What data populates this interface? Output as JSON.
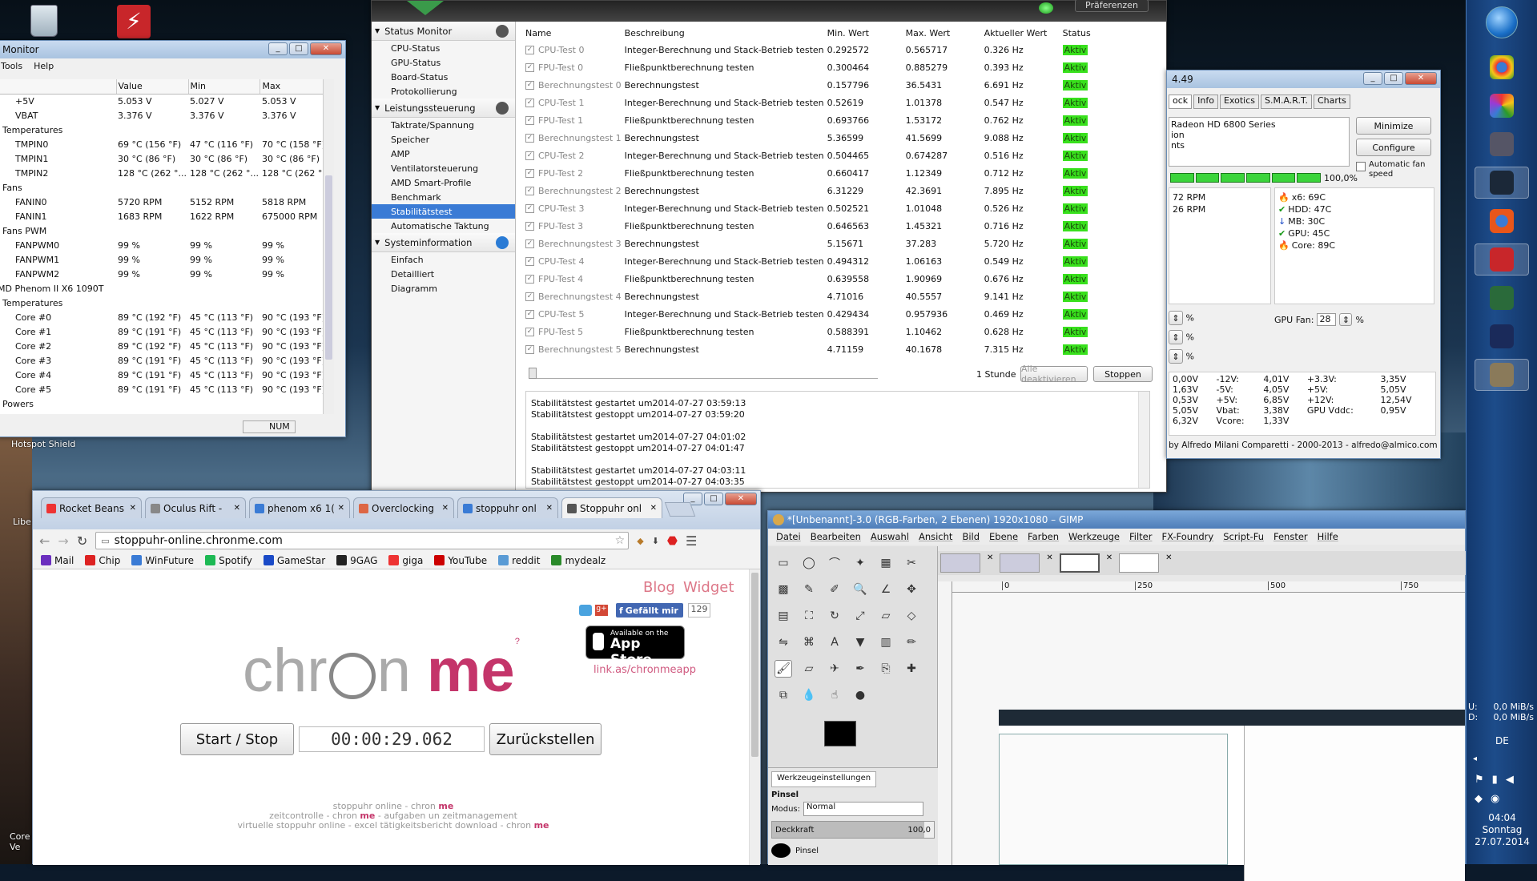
{
  "desktop": {
    "game_caption": "Hotspot Shield",
    "cut_label_1": "Libe",
    "cut_label_2": "Core\nVe"
  },
  "hwmonitor": {
    "title": "Monitor",
    "menu": [
      "Tools",
      "Help"
    ],
    "columns": [
      "",
      "Value",
      "Min",
      "Max"
    ],
    "rows": [
      {
        "indent": 2,
        "name": "+5V",
        "value": "5.053 V",
        "min": "5.027 V",
        "max": "5.053 V"
      },
      {
        "indent": 2,
        "name": "VBAT",
        "value": "3.376 V",
        "min": "3.376 V",
        "max": "3.376 V"
      },
      {
        "indent": 1,
        "name": "Temperatures",
        "value": "",
        "min": "",
        "max": ""
      },
      {
        "indent": 2,
        "name": "TMPIN0",
        "value": "69 °C  (156 °F)",
        "min": "47 °C  (116 °F)",
        "max": "70 °C  (158 °F)"
      },
      {
        "indent": 2,
        "name": "TMPIN1",
        "value": "30 °C  (86 °F)",
        "min": "30 °C  (86 °F)",
        "max": "30 °C  (86 °F)"
      },
      {
        "indent": 2,
        "name": "TMPIN2",
        "value": "128 °C  (262 °...",
        "min": "128 °C  (262 °...",
        "max": "128 °C  (262 °..."
      },
      {
        "indent": 1,
        "name": "Fans",
        "value": "",
        "min": "",
        "max": ""
      },
      {
        "indent": 2,
        "name": "FANIN0",
        "value": "5720 RPM",
        "min": "5152 RPM",
        "max": "5818 RPM"
      },
      {
        "indent": 2,
        "name": "FANIN1",
        "value": "1683 RPM",
        "min": "1622 RPM",
        "max": "675000 RPM"
      },
      {
        "indent": 1,
        "name": "Fans PWM",
        "value": "",
        "min": "",
        "max": ""
      },
      {
        "indent": 2,
        "name": "FANPWM0",
        "value": "99 %",
        "min": "99 %",
        "max": "99 %"
      },
      {
        "indent": 2,
        "name": "FANPWM1",
        "value": "99 %",
        "min": "99 %",
        "max": "99 %"
      },
      {
        "indent": 2,
        "name": "FANPWM2",
        "value": "99 %",
        "min": "99 %",
        "max": "99 %"
      },
      {
        "indent": 0,
        "name": "MD Phenom II X6 1090T",
        "value": "",
        "min": "",
        "max": ""
      },
      {
        "indent": 1,
        "name": "Temperatures",
        "value": "",
        "min": "",
        "max": ""
      },
      {
        "indent": 2,
        "name": "Core #0",
        "value": "89 °C  (192 °F)",
        "min": "45 °C  (113 °F)",
        "max": "90 °C  (193 °F)"
      },
      {
        "indent": 2,
        "name": "Core #1",
        "value": "89 °C  (191 °F)",
        "min": "45 °C  (113 °F)",
        "max": "90 °C  (193 °F)"
      },
      {
        "indent": 2,
        "name": "Core #2",
        "value": "89 °C  (192 °F)",
        "min": "45 °C  (113 °F)",
        "max": "90 °C  (193 °F)"
      },
      {
        "indent": 2,
        "name": "Core #3",
        "value": "89 °C  (191 °F)",
        "min": "45 °C  (113 °F)",
        "max": "90 °C  (193 °F)"
      },
      {
        "indent": 2,
        "name": "Core #4",
        "value": "89 °C  (191 °F)",
        "min": "45 °C  (113 °F)",
        "max": "90 °C  (193 °F)"
      },
      {
        "indent": 2,
        "name": "Core #5",
        "value": "89 °C  (191 °F)",
        "min": "45 °C  (113 °F)",
        "max": "90 °C  (193 °F)"
      },
      {
        "indent": 1,
        "name": "Powers",
        "value": "",
        "min": "",
        "max": ""
      }
    ],
    "status": "NUM"
  },
  "statusmon": {
    "top_button": "Präferenzen",
    "sections": [
      {
        "title": "Status Monitor",
        "items": [
          "CPU-Status",
          "GPU-Status",
          "Board-Status",
          "Protokollierung"
        ]
      },
      {
        "title": "Leistungssteuerung",
        "items": [
          "Taktrate/Spannung",
          "Speicher",
          "AMP",
          "Ventilatorsteuerung",
          "AMD Smart-Profile",
          "Benchmark",
          "Stabilitätstest",
          "Automatische Taktung"
        ]
      },
      {
        "title": "Systeminformation",
        "items": [
          "Einfach",
          "Detailliert",
          "Diagramm"
        ]
      }
    ],
    "selected_item": "Stabilitätstest",
    "columns": [
      "Name",
      "Beschreibung",
      "Min. Wert",
      "Max. Wert",
      "Aktueller Wert",
      "Status"
    ],
    "rows": [
      [
        "CPU-Test 0",
        "Integer-Berechnung und Stack-Betrieb testen",
        "0.292572",
        "0.565717",
        "0.326 Hz",
        "Aktiv"
      ],
      [
        "FPU-Test 0",
        "Fließpunktberechnung testen",
        "0.300464",
        "0.885279",
        "0.393 Hz",
        "Aktiv"
      ],
      [
        "Berechnungstest 0",
        "Berechnungstest",
        "0.157796",
        "36.5431",
        "6.691 Hz",
        "Aktiv"
      ],
      [
        "CPU-Test 1",
        "Integer-Berechnung und Stack-Betrieb testen",
        "0.52619",
        "1.01378",
        "0.547 Hz",
        "Aktiv"
      ],
      [
        "FPU-Test 1",
        "Fließpunktberechnung testen",
        "0.693766",
        "1.53172",
        "0.762 Hz",
        "Aktiv"
      ],
      [
        "Berechnungstest 1",
        "Berechnungstest",
        "5.36599",
        "41.5699",
        "9.088 Hz",
        "Aktiv"
      ],
      [
        "CPU-Test 2",
        "Integer-Berechnung und Stack-Betrieb testen",
        "0.504465",
        "0.674287",
        "0.516 Hz",
        "Aktiv"
      ],
      [
        "FPU-Test 2",
        "Fließpunktberechnung testen",
        "0.660417",
        "1.12349",
        "0.712 Hz",
        "Aktiv"
      ],
      [
        "Berechnungstest 2",
        "Berechnungstest",
        "6.31229",
        "42.3691",
        "7.895 Hz",
        "Aktiv"
      ],
      [
        "CPU-Test 3",
        "Integer-Berechnung und Stack-Betrieb testen",
        "0.502521",
        "1.01048",
        "0.526 Hz",
        "Aktiv"
      ],
      [
        "FPU-Test 3",
        "Fließpunktberechnung testen",
        "0.646563",
        "1.45321",
        "0.716 Hz",
        "Aktiv"
      ],
      [
        "Berechnungstest 3",
        "Berechnungstest",
        "5.15671",
        "37.283",
        "5.720 Hz",
        "Aktiv"
      ],
      [
        "CPU-Test 4",
        "Integer-Berechnung und Stack-Betrieb testen",
        "0.494312",
        "1.06163",
        "0.549 Hz",
        "Aktiv"
      ],
      [
        "FPU-Test 4",
        "Fließpunktberechnung testen",
        "0.639558",
        "1.90969",
        "0.676 Hz",
        "Aktiv"
      ],
      [
        "Berechnungstest 4",
        "Berechnungstest",
        "4.71016",
        "40.5557",
        "9.141 Hz",
        "Aktiv"
      ],
      [
        "CPU-Test 5",
        "Integer-Berechnung und Stack-Betrieb testen",
        "0.429434",
        "0.957936",
        "0.469 Hz",
        "Aktiv"
      ],
      [
        "FPU-Test 5",
        "Fließpunktberechnung testen",
        "0.588391",
        "1.10462",
        "0.628 Hz",
        "Aktiv"
      ],
      [
        "Berechnungstest 5",
        "Berechnungstest",
        "4.71159",
        "40.1678",
        "7.315 Hz",
        "Aktiv"
      ]
    ],
    "duration": "1 Stunde",
    "deactivate_all": "Alle deaktivieren",
    "stop": "Stoppen",
    "log": [
      "Stabilitätstest gestartet um2014-07-27 03:59:13",
      "Stabilitätstest gestoppt um2014-07-27 03:59:20",
      "",
      "Stabilitätstest gestartet um2014-07-27 04:01:02",
      "Stabilitätstest gestoppt um2014-07-27 04:01:47",
      "",
      "Stabilitätstest gestartet um2014-07-27 04:03:11",
      "Stabilitätstest gestoppt um2014-07-27 04:03:35"
    ]
  },
  "speedfan": {
    "title": "4.49",
    "tabs": [
      "ock",
      "Info",
      "Exotics",
      "S.M.A.R.T.",
      "Charts"
    ],
    "list": [
      "Radeon HD 6800 Series",
      "ion",
      "nts"
    ],
    "minimize": "Minimize",
    "configure": "Configure",
    "auto_fan": "Automatic fan speed",
    "cpu_usage": "100,0%",
    "rpms": [
      "72 RPM",
      "26 RPM"
    ],
    "temps": [
      {
        "label": "x6:",
        "value": "69C",
        "icon": "flame-icon"
      },
      {
        "label": "HDD:",
        "value": "47C",
        "icon": "check-icon"
      },
      {
        "label": "MB:",
        "value": "30C",
        "icon": "down-arrow-icon"
      },
      {
        "label": "GPU:",
        "value": "45C",
        "icon": "check-icon"
      },
      {
        "label": "Core:",
        "value": "89C",
        "icon": "flame-icon"
      }
    ],
    "gpu_fan_label": "GPU Fan:",
    "gpu_fan_value": "28",
    "pct": "%",
    "volts": [
      [
        "0,00V",
        "-12V:",
        "4,01V",
        "+3.3V:",
        "3,35V"
      ],
      [
        "1,63V",
        "-5V:",
        "4,05V",
        "+5V:",
        "5,05V"
      ],
      [
        "0,53V",
        "+5V:",
        "6,85V",
        "+12V:",
        "12,54V"
      ],
      [
        "5,05V",
        "Vbat:",
        "3,38V",
        "GPU Vddc:",
        "0,95V"
      ],
      [
        "6,32V",
        "Vcore:",
        "1,33V",
        "",
        ""
      ]
    ],
    "footer": "by Alfredo Milani Comparetti - 2000-2013 - alfredo@almico.com"
  },
  "chrome": {
    "tabs": [
      "Rocket Beans",
      "Oculus Rift -",
      "phenom x6 1(",
      "Overclocking",
      "stoppuhr onl",
      "Stoppuhr onl"
    ],
    "url": "stoppuhr-online.chronme.com",
    "bookmarks": [
      "Mail",
      "Chip",
      "WinFuture",
      "Spotify",
      "GameStar",
      "9GAG",
      "giga",
      "YouTube",
      "reddit",
      "mydealz"
    ],
    "blog": "Blog",
    "widget": "Widget",
    "fb_like": "Gefällt mir",
    "fb_count": "129",
    "logo_left": "chr",
    "logo_mid": "n",
    "logo_right": "me",
    "logo_sup": "?",
    "appstore_small": "Available on the",
    "appstore_big": "App Store",
    "app_link": "link.as/chronmeapp",
    "start_stop": "Start / Stop",
    "timer": "00:00:29.062",
    "reset": "Zurückstellen",
    "footer1": "stoppuhr online - chron ",
    "footer1b": "me",
    "footer2": "zeitcontrolle - chron ",
    "footer2b": "me",
    "footer2c": " - aufgaben un zeitmanagement",
    "footer3": "virtuelle stoppuhr online - excel tätigkeitsbericht download - chron ",
    "footer3b": "me"
  },
  "gimp": {
    "title": "*[Unbenannt]-3.0 (RGB-Farben, 2 Ebenen) 1920x1080 – GIMP",
    "menu": [
      "Datei",
      "Bearbeiten",
      "Auswahl",
      "Ansicht",
      "Bild",
      "Ebene",
      "Farben",
      "Werkzeuge",
      "Filter",
      "FX-Foundry",
      "Script-Fu",
      "Fenster",
      "Hilfe"
    ],
    "ruler": [
      "0",
      "250",
      "500",
      "750"
    ],
    "tool_options_title": "Werkzeugeinstellungen",
    "tool_name": "Pinsel",
    "mode_label": "Modus:",
    "mode_value": "Normal",
    "opacity_label": "Deckkraft",
    "opacity_value": "100,0",
    "brush_label": "Pinsel"
  },
  "tray": {
    "net_up": "0,0 MiB/s",
    "net_down": "0,0 MiB/s",
    "net_u": "U:",
    "net_d": "D:",
    "lang": "DE",
    "time": "04:04",
    "day": "Sonntag",
    "date": "27.07.2014"
  }
}
